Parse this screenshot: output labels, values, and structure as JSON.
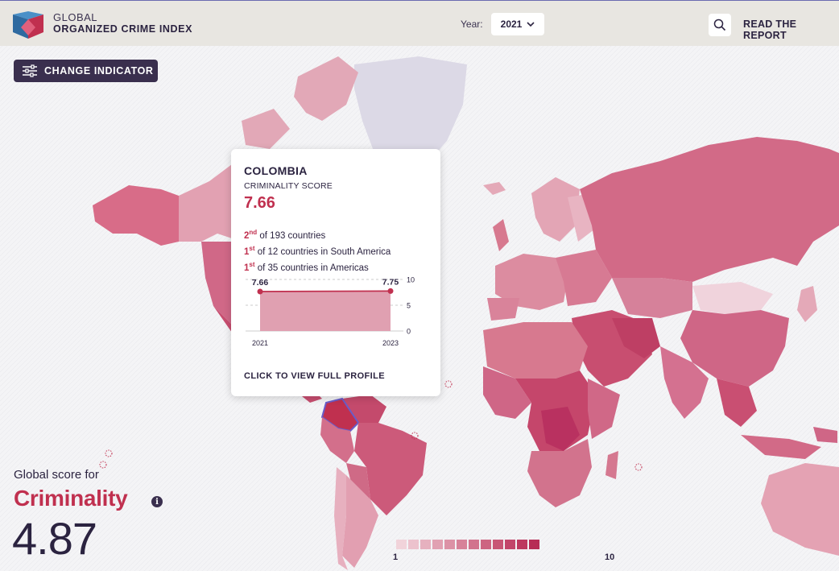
{
  "header": {
    "brand_line1": "GLOBAL",
    "brand_line2": "ORGANIZED CRIME INDEX",
    "year_label": "Year:",
    "year_value": "2021",
    "read_report": "READ THE REPORT"
  },
  "controls": {
    "change_indicator": "CHANGE INDICATOR"
  },
  "tooltip": {
    "country": "COLOMBIA",
    "metric": "CRIMINALITY SCORE",
    "score": "7.66",
    "ranks": [
      {
        "ord": "2",
        "suffix": "nd",
        "text": " of 193 countries"
      },
      {
        "ord": "1",
        "suffix": "st",
        "text": " of 12 countries in South America"
      },
      {
        "ord": "1",
        "suffix": "st",
        "text": " of 35 countries in Americas"
      }
    ],
    "cta": "CLICK TO VIEW FULL PROFILE"
  },
  "chart_data": {
    "type": "area",
    "x": [
      "2021",
      "2023"
    ],
    "values": [
      7.66,
      7.75
    ],
    "value_labels": [
      "7.66",
      "7.75"
    ],
    "ylim": [
      0,
      10
    ],
    "y_ticks": [
      "10",
      "5",
      "0"
    ],
    "x_ticks": [
      "2021",
      "2023"
    ],
    "color": "#c0304f"
  },
  "global": {
    "label": "Global score for",
    "indicator": "Criminality",
    "info_icon": "i",
    "score": "4.87"
  },
  "legend": {
    "min": "1",
    "max": "10",
    "colors": [
      "#f1d3da",
      "#ecc2cd",
      "#e6b1bf",
      "#e1a1b2",
      "#dc92a6",
      "#d78299",
      "#d2738d",
      "#cd6481",
      "#c85575",
      "#c2456a",
      "#bd385f",
      "#b72c55"
    ]
  },
  "colors": {
    "accent": "#c0304f",
    "dark": "#3a2f4e",
    "highlight": "#6a5cc8"
  }
}
